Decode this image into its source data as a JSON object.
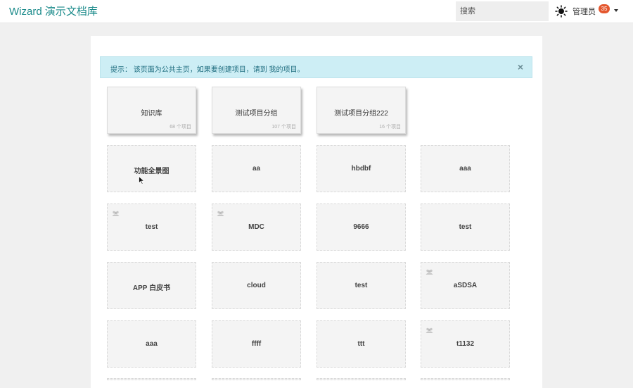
{
  "header": {
    "brand": "Wizard 演示文档库",
    "search_placeholder": "搜索",
    "user_label": "管理员",
    "badge_count": "35"
  },
  "alert": {
    "text": "提示：  该页面为公共主页，如果要创建项目，请到 我的项目。",
    "close": "×"
  },
  "groups": [
    {
      "title": "知识库",
      "count": "68 个项目"
    },
    {
      "title": "测试项目分组",
      "count": "107 个项目"
    },
    {
      "title": "测试项目分组222",
      "count": "16 个项目"
    }
  ],
  "projects": [
    {
      "title": "功能全景图",
      "team_icon": false
    },
    {
      "title": "aa",
      "team_icon": false
    },
    {
      "title": "hbdbf",
      "team_icon": false
    },
    {
      "title": "aaa",
      "team_icon": false
    },
    {
      "title": "test",
      "team_icon": true
    },
    {
      "title": "MDC",
      "team_icon": true
    },
    {
      "title": "9666",
      "team_icon": false
    },
    {
      "title": "test",
      "team_icon": false
    },
    {
      "title": "APP 白皮书",
      "team_icon": false
    },
    {
      "title": "cloud",
      "team_icon": false
    },
    {
      "title": "test",
      "team_icon": false
    },
    {
      "title": "aSDSA",
      "team_icon": true
    },
    {
      "title": "aaa",
      "team_icon": false
    },
    {
      "title": "ffff",
      "team_icon": false
    },
    {
      "title": "ttt",
      "team_icon": false
    },
    {
      "title": "t1132",
      "team_icon": true
    }
  ],
  "colors": {
    "brand": "#1a8a8a",
    "badge": "#e4572e",
    "alert_bg": "#cdeef5"
  }
}
